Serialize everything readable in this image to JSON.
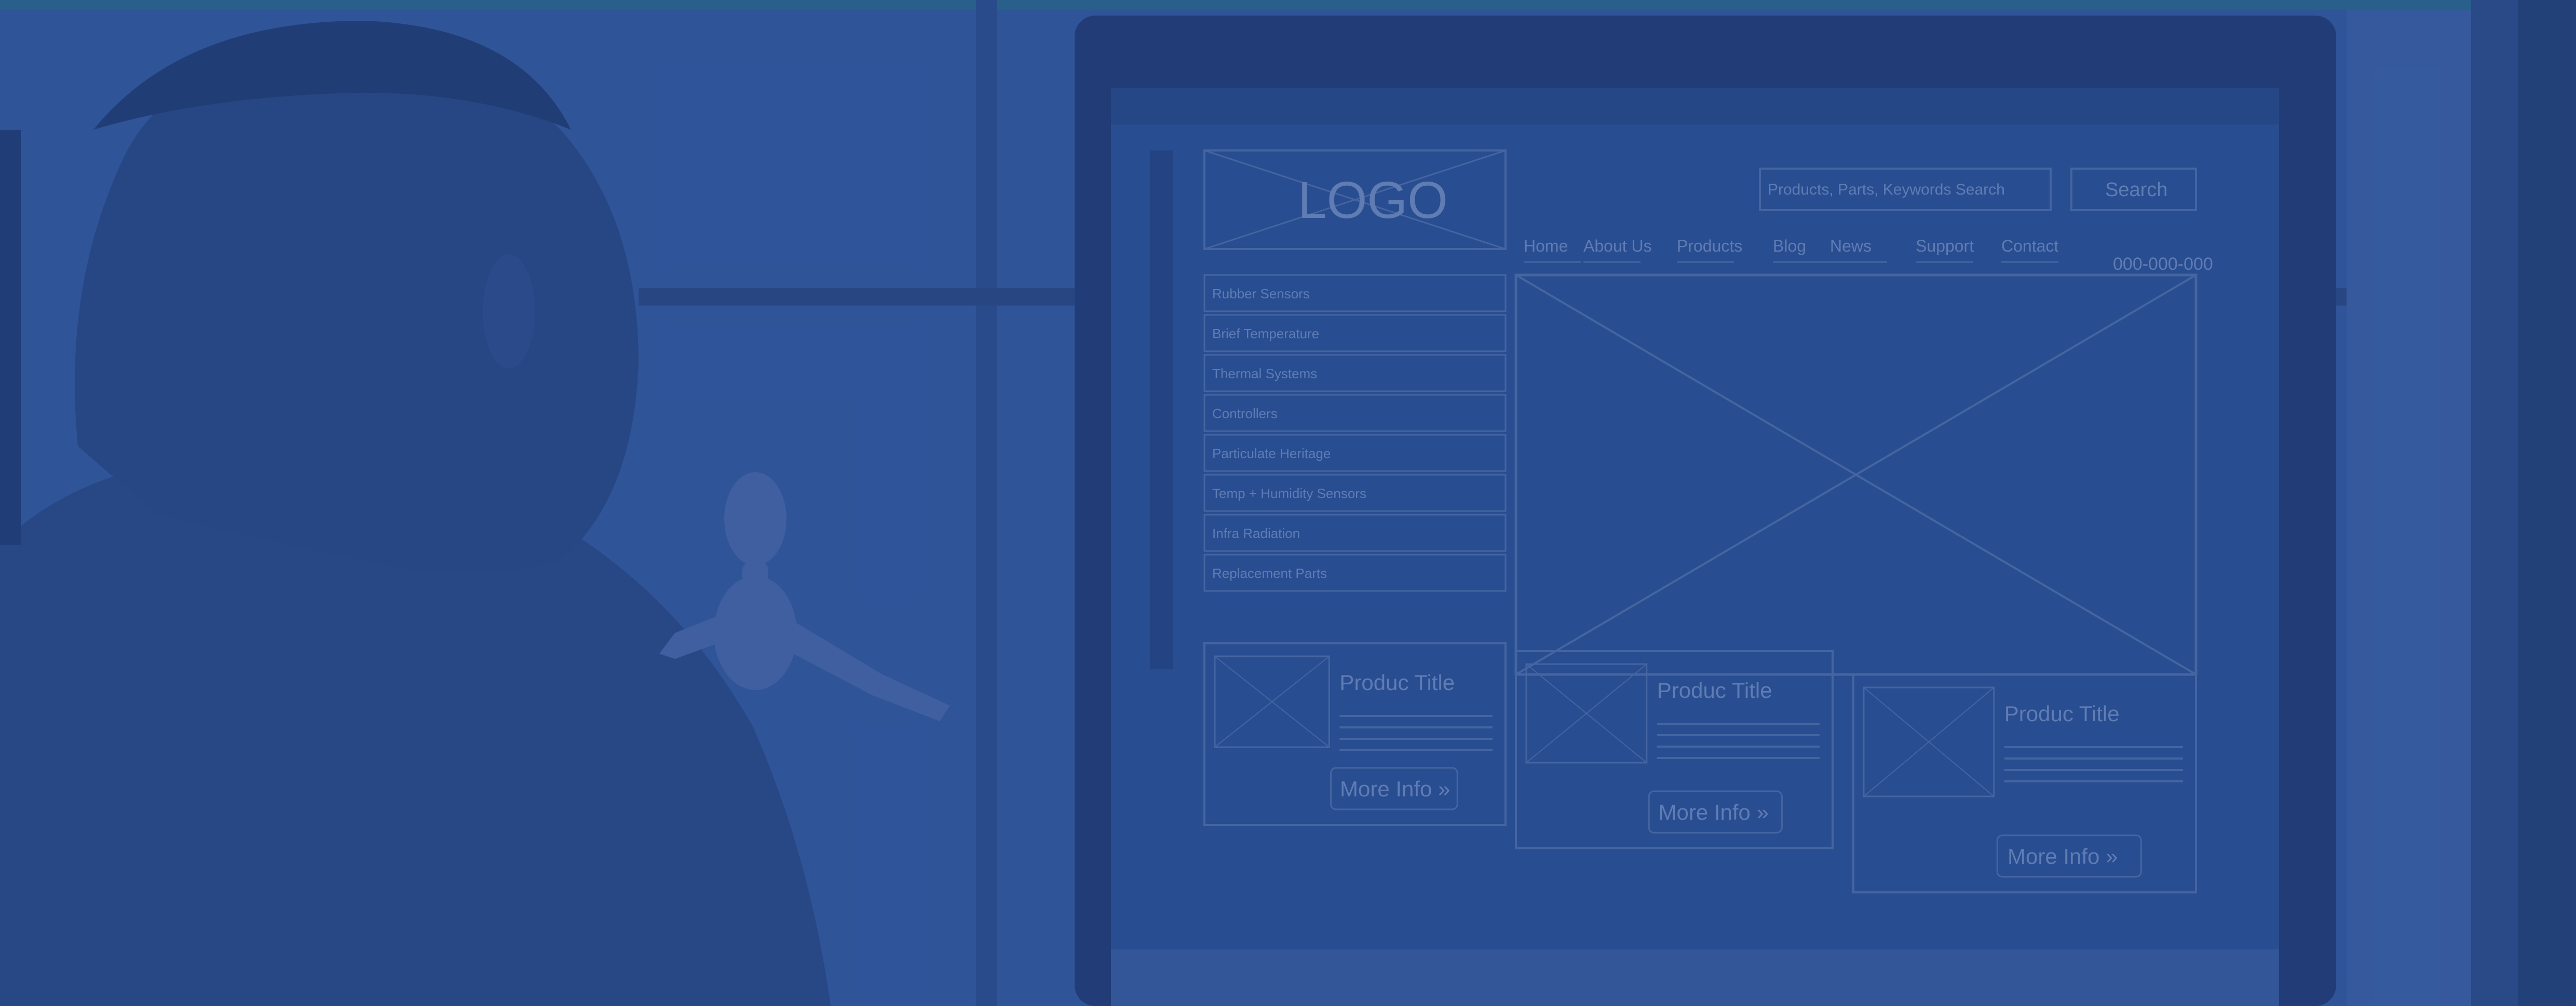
{
  "photo": {
    "tint_color": "#2f5597",
    "background_color": "#36599a"
  },
  "monitor_wireframe": {
    "logo_text": "LOGO",
    "search": {
      "placeholder": "Products, Parts, Keywords Search",
      "button_label": "Search"
    },
    "nav": [
      "Home",
      "About Us",
      "Products",
      "Blog",
      "News",
      "Support",
      "Contact"
    ],
    "phone": "000-000-000",
    "sidebar_items": [
      "Rubber Sensors",
      "Brief Temperature",
      "Thermal Systems",
      "Controllers",
      "Particulate Heritage",
      "Temp + Humidity Sensors",
      "Infra Radiation",
      "Replacement Parts"
    ],
    "products": [
      {
        "title": "Produc Title",
        "more_label": "More Info »"
      },
      {
        "title": "Produc Title",
        "more_label": "More Info »"
      },
      {
        "title": "Produc Title",
        "more_label": "More Info »"
      }
    ]
  }
}
